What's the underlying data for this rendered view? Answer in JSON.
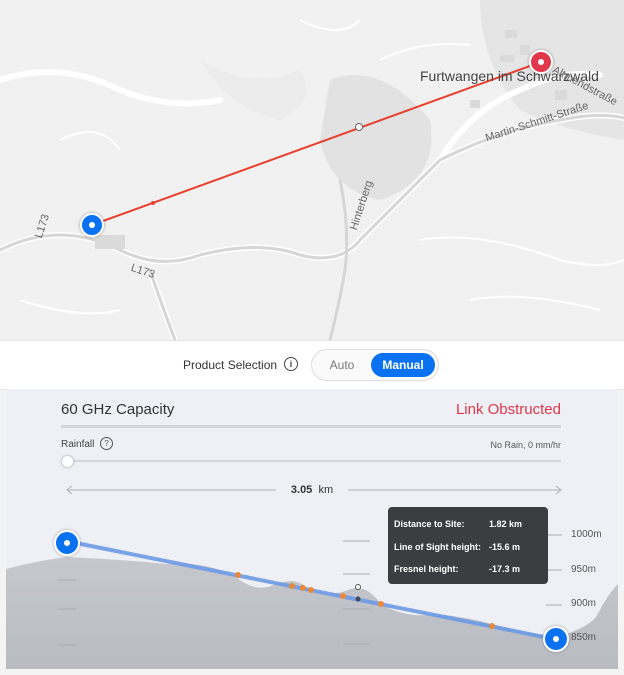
{
  "map": {
    "town_name": "Furtwangen im Schwarzwald",
    "roads": {
      "altmendstrasse": "Altmendstraße",
      "martin_schmitt": "Martin-Schmitt-Straße",
      "hinterberg": "Hinterberg",
      "l173_a": "L173",
      "l173_b": "L173"
    },
    "site_a_color": "#0a72f0",
    "site_b_color": "#e0384a",
    "link_line_color": "#e8402c"
  },
  "product_selection": {
    "label": "Product Selection",
    "info_icon": "i",
    "options": [
      "Auto",
      "Manual"
    ],
    "selected": "Manual"
  },
  "panel": {
    "title": "60 GHz Capacity",
    "status": "Link Obstructed",
    "rainfall_label": "Rainfall",
    "help_icon": "?",
    "rainfall_value": "No Rain, 0 mm/hr",
    "rainfall_level": 0,
    "distance_value": "3.05",
    "distance_unit": "km",
    "elevation_ticks": [
      "1000m",
      "950m",
      "900m",
      "850m"
    ],
    "tooltip": {
      "rows": [
        {
          "label": "Distance to Site:",
          "value": "1.82 km"
        },
        {
          "label": "Line of Sight height:",
          "value": "-15.6 m"
        },
        {
          "label": "Fresnel height:",
          "value": "-17.3 m"
        }
      ]
    }
  },
  "colors": {
    "accent": "#0a72f0",
    "obstructed": "#e0384a",
    "terrain": "#c9cbd1",
    "los_line": "#6e9be6",
    "obstruction_point": "#e88a3c"
  }
}
